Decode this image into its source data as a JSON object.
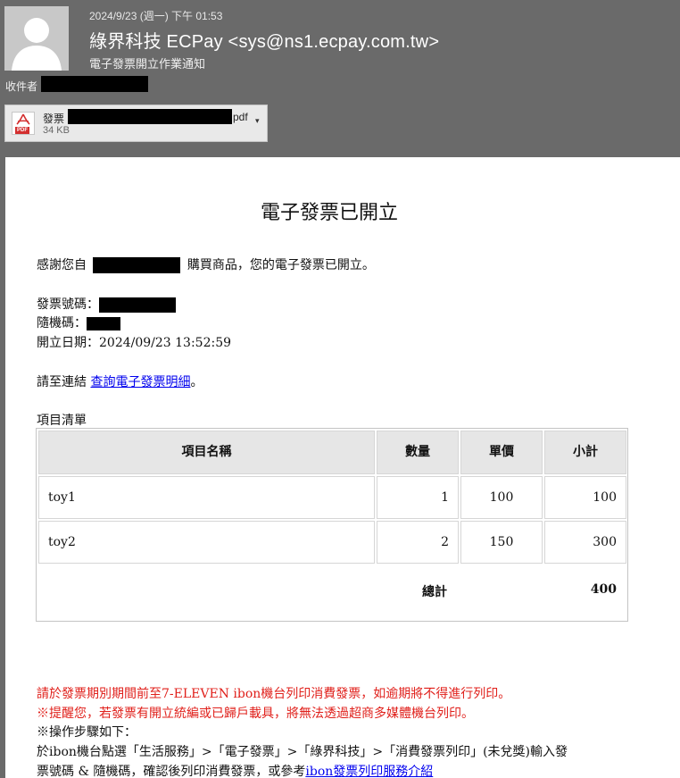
{
  "header": {
    "date": "2024/9/23 (週一) 下午 01:53",
    "from": "綠界科技 ECPay <sys@ns1.ecpay.com.tw>",
    "subject": "電子發票開立作業通知",
    "recipient_label": "收件者"
  },
  "attachment": {
    "name_prefix": "發票",
    "extension": "pdf",
    "size": "34 KB",
    "badge": "PDF"
  },
  "body": {
    "title": "電子發票已開立",
    "thanks_before": "感謝您自",
    "thanks_after": "購買商品，您的電子發票已開立。",
    "invoice_no_label": "發票號碼：",
    "random_code_label": "隨機碼：",
    "issue_date": "開立日期：2024/09/23 13:52:59",
    "link_prefix": "請至連結",
    "link_text": "查詢電子發票明細",
    "link_suffix": "。",
    "items_title": "項目清單",
    "table": {
      "columns": [
        "項目名稱",
        "數量",
        "單價",
        "小計"
      ],
      "rows": [
        {
          "name": "toy1",
          "qty": "1",
          "price": "100",
          "subtotal": "100"
        },
        {
          "name": "toy2",
          "qty": "2",
          "price": "150",
          "subtotal": "300"
        }
      ],
      "total_label": "總計",
      "total_value": "400"
    },
    "notice_1": "請於發票期別期間前至7-ELEVEN ibon機台列印消費發票，如逾期將不得進行列印。",
    "notice_2": "※提醒您，若發票有開立統編或已歸戶載具，將無法透過超商多媒體機台列印。",
    "steps_title": "※操作步驟如下：",
    "steps_line1": "於ibon機台點選「生活服務」>「電子發票」>「綠界科技」>「消費發票列印」(未兌獎)輸入發",
    "steps_line2_prefix": "票號碼 & 隨機碼，確認後列印消費發票，或參考",
    "steps_link": "ibon發票列印服務介紹"
  },
  "colors": {
    "header_bg": "#6a6a6a",
    "notice_red": "#e0201b",
    "link_blue": "#0000ee"
  }
}
